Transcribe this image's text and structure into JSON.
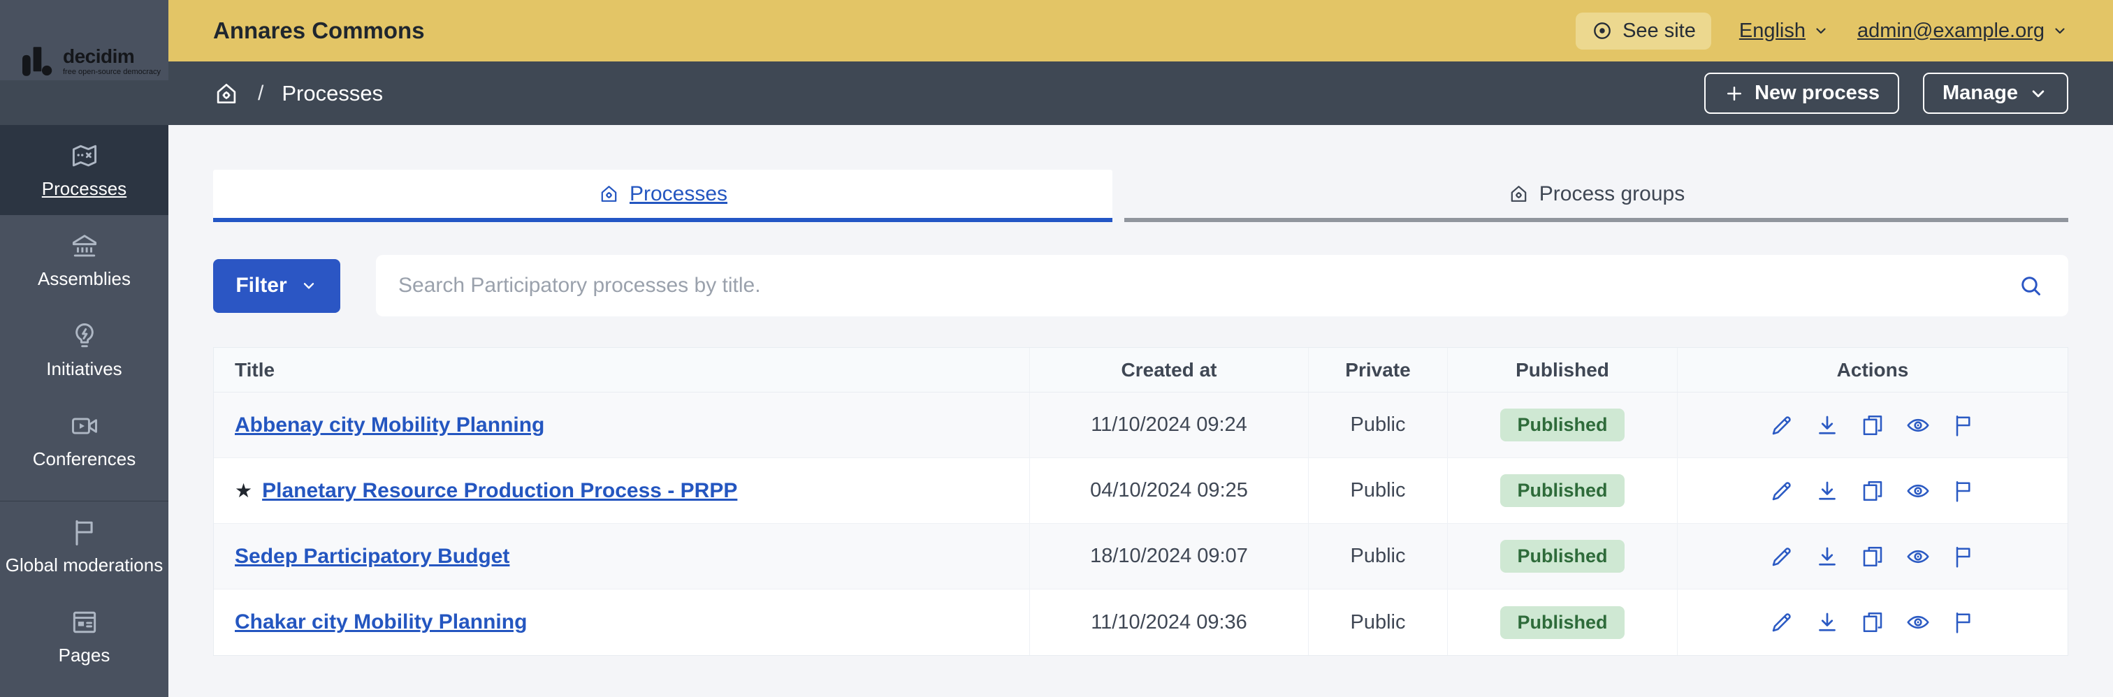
{
  "logo": {
    "brand": "decidim",
    "tagline": "free open-source democracy"
  },
  "topbar": {
    "title": "Annares Commons",
    "see_site": "See site",
    "language": "English",
    "account": "admin@example.org"
  },
  "subbar": {
    "breadcrumb_separator": "/",
    "breadcrumb_page": "Processes",
    "new_process_label": "New process",
    "manage_label": "Manage"
  },
  "sidebar": {
    "items": [
      {
        "label": "Processes",
        "icon": "map-icon",
        "active": true
      },
      {
        "label": "Assemblies",
        "icon": "bank-icon",
        "active": false
      },
      {
        "label": "Initiatives",
        "icon": "lightbulb-icon",
        "active": false
      },
      {
        "label": "Conferences",
        "icon": "video-icon",
        "active": false
      },
      {
        "label": "Global moderations",
        "icon": "flag-icon",
        "active": false
      },
      {
        "label": "Pages",
        "icon": "pages-icon",
        "active": false
      }
    ]
  },
  "tabs": [
    {
      "label": "Processes",
      "icon": "home-gear-icon",
      "active": true
    },
    {
      "label": "Process groups",
      "icon": "home-gear-icon",
      "active": false
    }
  ],
  "filter": {
    "button_label": "Filter",
    "search_placeholder": "Search Participatory processes by title."
  },
  "table": {
    "columns": {
      "title": "Title",
      "created_at": "Created at",
      "private": "Private",
      "published": "Published",
      "actions": "Actions"
    },
    "action_icons": [
      "edit-pencil",
      "download",
      "duplicate",
      "preview-eye",
      "moderation-flag"
    ],
    "rows": [
      {
        "title": "Abbenay city Mobility Planning",
        "created_at": "11/10/2024 09:24",
        "private": "Public",
        "published": "Published"
      },
      {
        "title": "Planetary Resource Production Process - PRPP",
        "star": "★",
        "created_at": "04/10/2024 09:25",
        "private": "Public",
        "published": "Published"
      },
      {
        "title": "Sedep Participatory Budget",
        "created_at": "18/10/2024 09:07",
        "private": "Public",
        "published": "Published"
      },
      {
        "title": "Chakar city Mobility Planning",
        "created_at": "11/10/2024 09:36",
        "private": "Public",
        "published": "Published"
      }
    ]
  },
  "colors": {
    "topbar_yellow": "#e3c566",
    "sidebar_gray": "#49515f",
    "sidebar_active": "#2c3542",
    "subbar_slate": "#3f4854",
    "accent_blue": "#2b56c4",
    "link_blue": "#2456c0",
    "inactive_tab_border": "#90959d",
    "badge_background": "#cfe8d3",
    "badge_text": "#2e6b3a",
    "content_background": "#f4f5f8"
  }
}
